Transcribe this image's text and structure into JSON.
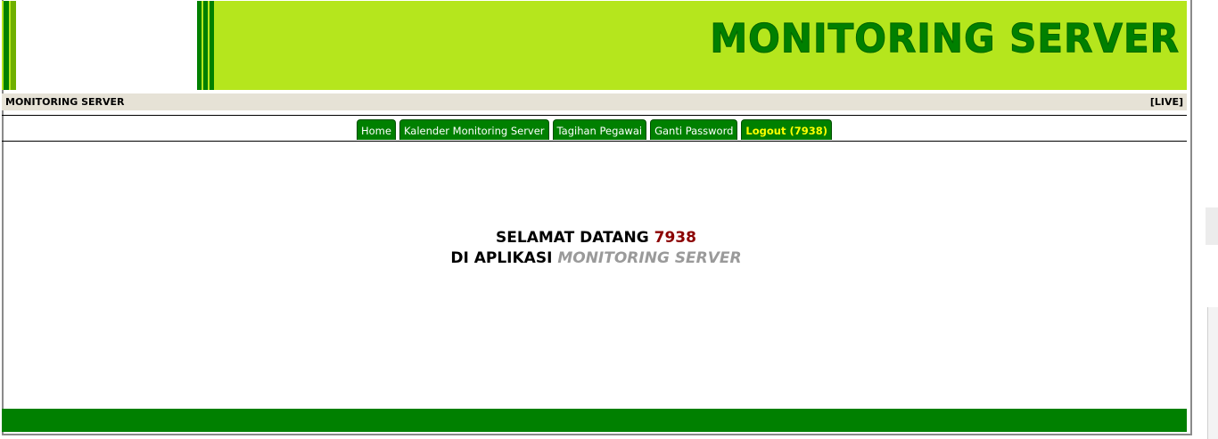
{
  "header": {
    "title": "MONITORING SERVER",
    "colors": {
      "banner": "#b5e61d",
      "dark_green": "#008000"
    }
  },
  "info_bar": {
    "left_text": "MONITORING SERVER",
    "right_text": "[LIVE]"
  },
  "nav": {
    "items": [
      {
        "label": "Home"
      },
      {
        "label": "Kalender Monitoring Server"
      },
      {
        "label": "Tagihan Pegawai"
      },
      {
        "label": "Ganti Password"
      },
      {
        "label": "Logout (7938)"
      }
    ]
  },
  "welcome": {
    "line1_prefix": "SELAMAT DATANG",
    "user_id": "7938",
    "line2_prefix": "DI APLIKASI",
    "app_name": "MONITORING SERVER"
  }
}
